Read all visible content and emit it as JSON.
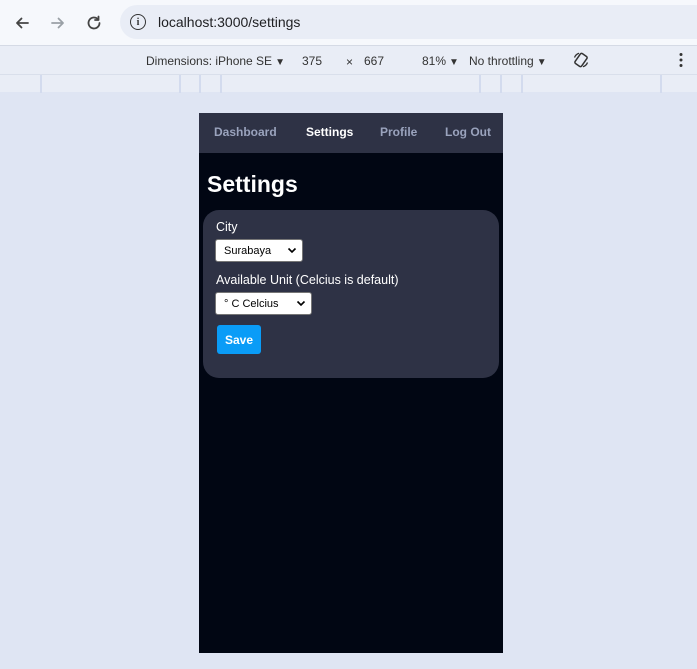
{
  "browser": {
    "url": "localhost:3000/settings"
  },
  "device_toolbar": {
    "dimensions_label": "Dimensions: iPhone SE",
    "width": "375",
    "times": "×",
    "height": "667",
    "zoom": "81%",
    "throttling": "No throttling"
  },
  "app": {
    "nav": {
      "dashboard": "Dashboard",
      "settings": "Settings",
      "profile": "Profile",
      "logout": "Log Out"
    },
    "title": "Settings",
    "form": {
      "city_label": "City",
      "city_value": "Surabaya",
      "unit_label": "Available Unit (Celcius is default)",
      "unit_value": "° C Celcius",
      "save_label": "Save"
    }
  },
  "colors": {
    "accent": "#0a9cf7",
    "app_bg": "#010613",
    "card_bg": "#2e3245"
  }
}
